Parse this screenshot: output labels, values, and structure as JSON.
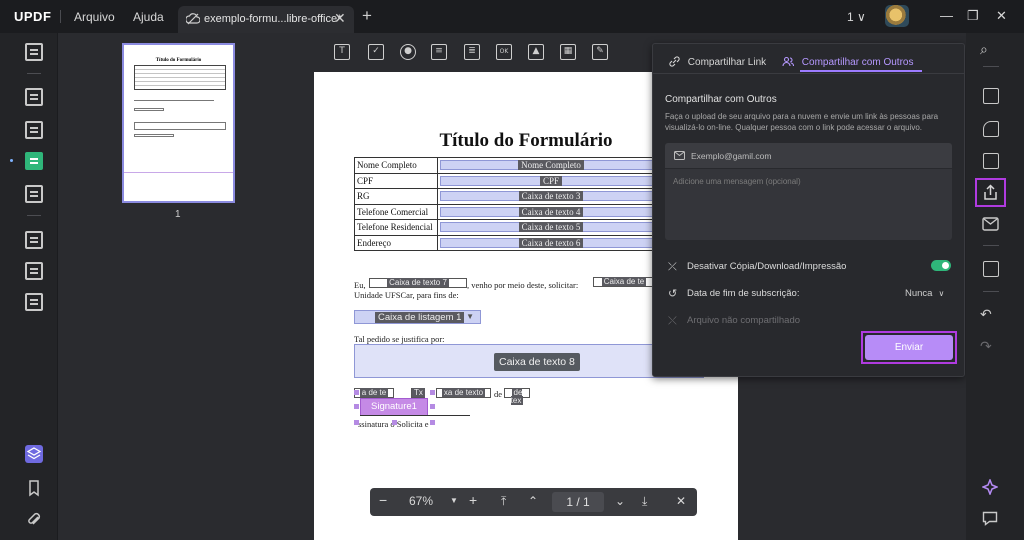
{
  "app": {
    "logo": "UPDF",
    "menu": [
      "Arquivo",
      "Ajuda"
    ],
    "tab_title": "exemplo-formu...libre-office*",
    "tab_close": "✕",
    "new_tab": "+",
    "page_selector": "1 ∨",
    "window_controls": [
      "—",
      "❐",
      "✕"
    ]
  },
  "thumbnails": {
    "page_number": "1",
    "mini_title": "Título do Formulário"
  },
  "form_tools": [
    "text-field-icon",
    "checkbox-icon",
    "radio-icon",
    "combobox-icon",
    "listbox-icon",
    "button-icon",
    "image-icon",
    "date-icon",
    "signature-icon"
  ],
  "document": {
    "title": "Título do Formulário",
    "rows": [
      {
        "label": "Nome Completo",
        "field": "Nome Completo"
      },
      {
        "label": "CPF",
        "field": "CPF"
      },
      {
        "label": "RG",
        "field": "Caixa de texto 3"
      },
      {
        "label": "Telefone Comercial",
        "field": "Caixa de texto 4"
      },
      {
        "label": "Telefone Residencial",
        "field": "Caixa de texto 5"
      },
      {
        "label": "Endereço",
        "field": "Caixa de texto 6"
      }
    ],
    "para1_a": "Eu,",
    "field7": "Caixa de texto 7",
    "para1_b": ", venho por meio deste, solicitar:",
    "field_right": "Caixa de te",
    "para1_c": "Unidade UFSCar, para fins de:",
    "listbox": "Caixa de listagem 1",
    "para2": "Tal pedido se justifica por:",
    "field8": "Caixa de texto 8",
    "date_fields": [
      "a de te",
      "Tx",
      "xa de texto",
      "de tex"
    ],
    "date_de": "de",
    "signature": "Signature1",
    "sign_line": "ssinatura   o Solicita   e"
  },
  "zoom_bar": {
    "zoom_out": "−",
    "zoom_level": "67%",
    "zoom_in": "+",
    "page_indicator": "1  /  1",
    "close": "✕"
  },
  "share_panel": {
    "tab_link": "Compartilhar Link",
    "tab_others": "Compartilhar com Outros",
    "heading": "Compartilhar com Outros",
    "description": "Faça o upload de seu arquivo para a nuvem e envie um link às pessoas para visualizá-lo on-line. Qualquer pessoa com o link pode acessar o arquivo.",
    "email_placeholder": "Exemplo@gamil.com",
    "message_placeholder": "Adicione uma mensagem (opcional)",
    "option_disable": "Desativar Cópia/Download/Impressão",
    "option_disable_enabled": true,
    "option_expiry": "Data de fim de subscrição:",
    "expiry_value": "Nunca",
    "option_unshared": "Arquivo não compartilhado",
    "send_button": "Enviar",
    "accent_color": "#b78cf7"
  }
}
